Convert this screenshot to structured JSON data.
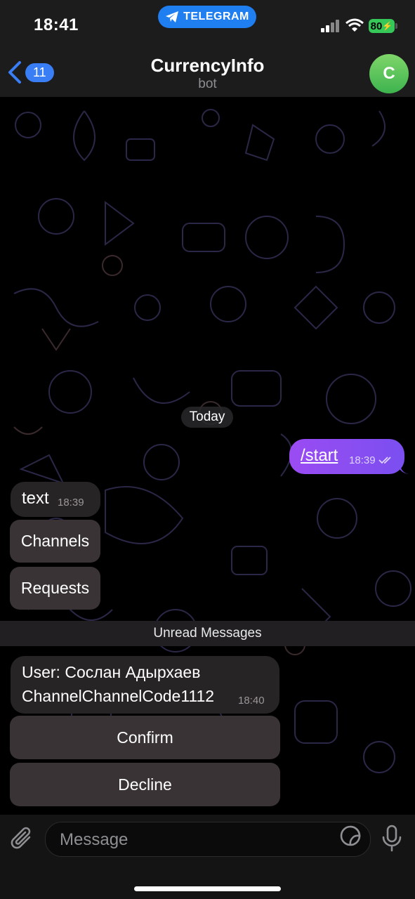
{
  "status_bar": {
    "time": "18:41",
    "app_pill": "TELEGRAM",
    "battery": "80"
  },
  "header": {
    "back_count": "11",
    "title": "CurrencyInfo",
    "subtitle": "bot",
    "avatar_letter": "C"
  },
  "chat": {
    "date_divider": "Today",
    "outgoing": {
      "text": "/start",
      "time": "18:39"
    },
    "bot_message_1": {
      "text": "text",
      "time": "18:39",
      "buttons": [
        "Channels",
        "Requests"
      ]
    },
    "unread_divider": "Unread Messages",
    "bot_message_2": {
      "line1": "User: Сослан Адырхаев",
      "line2": "ChannelChannelCode1112",
      "time": "18:40",
      "buttons": [
        "Confirm",
        "Decline"
      ]
    }
  },
  "composer": {
    "placeholder": "Message"
  },
  "colors": {
    "accent": "#3a7ef5",
    "outgoing_bubble": "#8a4df1",
    "avatar": "#4cbf55"
  }
}
